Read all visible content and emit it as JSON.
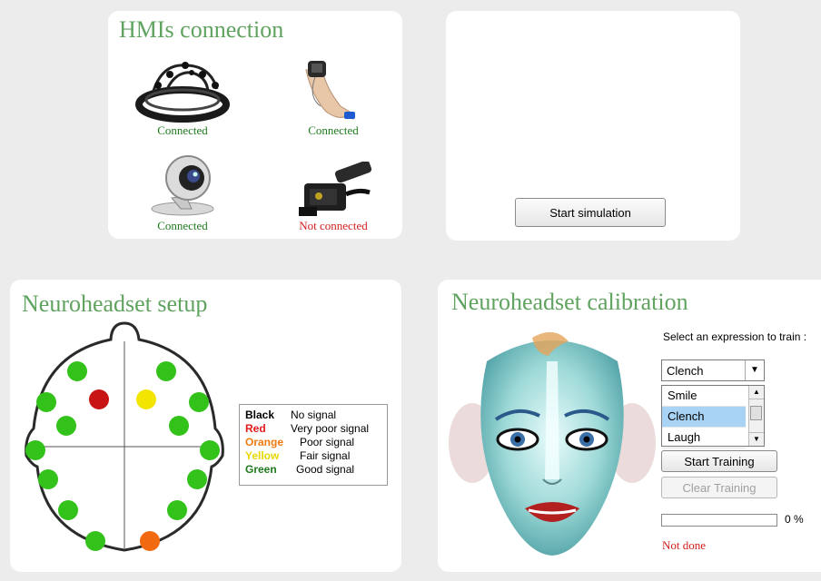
{
  "hmi": {
    "title": "HMIs connection",
    "devices": [
      {
        "name": "eeg-headset",
        "status": "Connected",
        "status_color": "#1e7a1e"
      },
      {
        "name": "wrist-sensor",
        "status": "Connected",
        "status_color": "#1e7a1e"
      },
      {
        "name": "webcam",
        "status": "Connected",
        "status_color": "#1e7a1e"
      },
      {
        "name": "wheelchair-controller",
        "status": "Not connected",
        "status_color": "#d12020"
      }
    ]
  },
  "simulation": {
    "start_label": "Start simulation"
  },
  "setup": {
    "title": "Neuroheadset setup",
    "electrode_colors": [
      "green",
      "green",
      "green",
      "red",
      "yellow",
      "green",
      "green",
      "green",
      "green",
      "green",
      "green",
      "green",
      "green",
      "green",
      "green",
      "orange"
    ],
    "legend": [
      {
        "key": "Black",
        "desc": "No signal",
        "color": "#000000"
      },
      {
        "key": "Red",
        "desc": "Very poor signal",
        "color": "#e01b1b"
      },
      {
        "key": "Orange",
        "desc": "Poor signal",
        "color": "#f07a10"
      },
      {
        "key": "Yellow",
        "desc": "Fair signal",
        "color": "#e8d800"
      },
      {
        "key": "Green",
        "desc": "Good signal",
        "color": "#1d7a1d"
      }
    ]
  },
  "calibration": {
    "title": "Neuroheadset calibration",
    "prompt": "Select an expression to train :",
    "selected": "Clench",
    "options": [
      "Smile",
      "Clench",
      "Laugh"
    ],
    "start_training": "Start Training",
    "clear_training": "Clear Training",
    "progress": 0,
    "progress_label": "0 %",
    "status": "Not done",
    "status_color": "#d12020"
  },
  "colors": {
    "title_green": "#5fa35f",
    "electrode_green": "#33c21a",
    "electrode_red": "#c81414",
    "electrode_yellow": "#f2e600",
    "electrode_orange": "#f26a10"
  }
}
